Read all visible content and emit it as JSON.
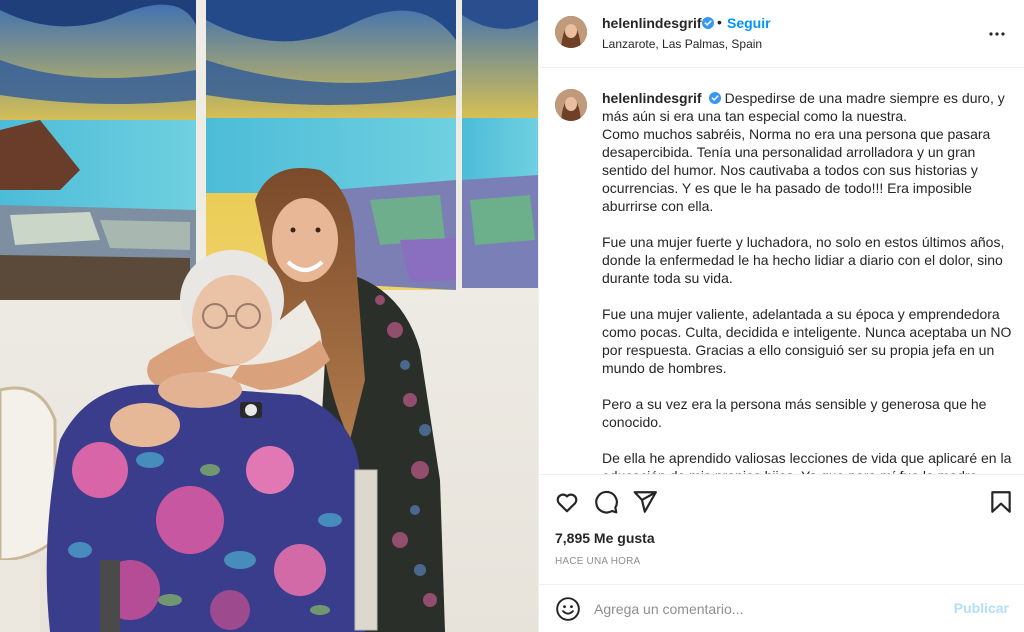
{
  "post": {
    "username": "helenlindesgrif",
    "verified": true,
    "separator": "•",
    "follow_label": "Seguir",
    "location": "Lanzarote, Las Palmas, Spain",
    "more_icon": "more-options-icon"
  },
  "caption": {
    "username": "helenlindesgrif",
    "paragraphs": [
      "Despedirse de una madre siempre es duro, y más aún si era una tan especial como la nuestra.\nComo muchos sabréis, Norma no era una persona que pasara desapercibida. Tenía una personalidad arrolladora y un gran sentido del humor. Nos cautivaba a todos con sus historias y ocurrencias. Y es que le ha pasado de todo!!! Era imposible aburrirse con ella.",
      "Fue una mujer fuerte y luchadora, no solo en estos últimos años, donde la enfermedad le ha hecho lidiar a diario con el dolor, sino durante toda su vida.",
      "Fue una mujer valiente, adelantada a su época y emprendedora como pocas. Culta, decidida e inteligente. Nunca aceptaba un NO por respuesta. Gracias a ello consiguió ser su propia jefa en un mundo de hombres.",
      "Pero a su vez era la persona más sensible y generosa que he conocido.",
      "De ella he aprendido valiosas lecciones de vida que aplicaré en la educación de mis propios hijos. Ya que para mí fue la madre perfecta."
    ]
  },
  "actions": {
    "icons": [
      "heart-icon",
      "comment-icon",
      "share-icon",
      "bookmark-icon"
    ],
    "likes": "7,895 Me gusta",
    "time": "HACE UNA HORA"
  },
  "comment": {
    "placeholder": "Agrega un comentario...",
    "publish_label": "Publicar"
  },
  "colors": {
    "accent": "#0095f6",
    "publish_disabled": "#b2dffc",
    "text": "#262626",
    "muted": "#8e8e8e",
    "border": "#efefef"
  }
}
